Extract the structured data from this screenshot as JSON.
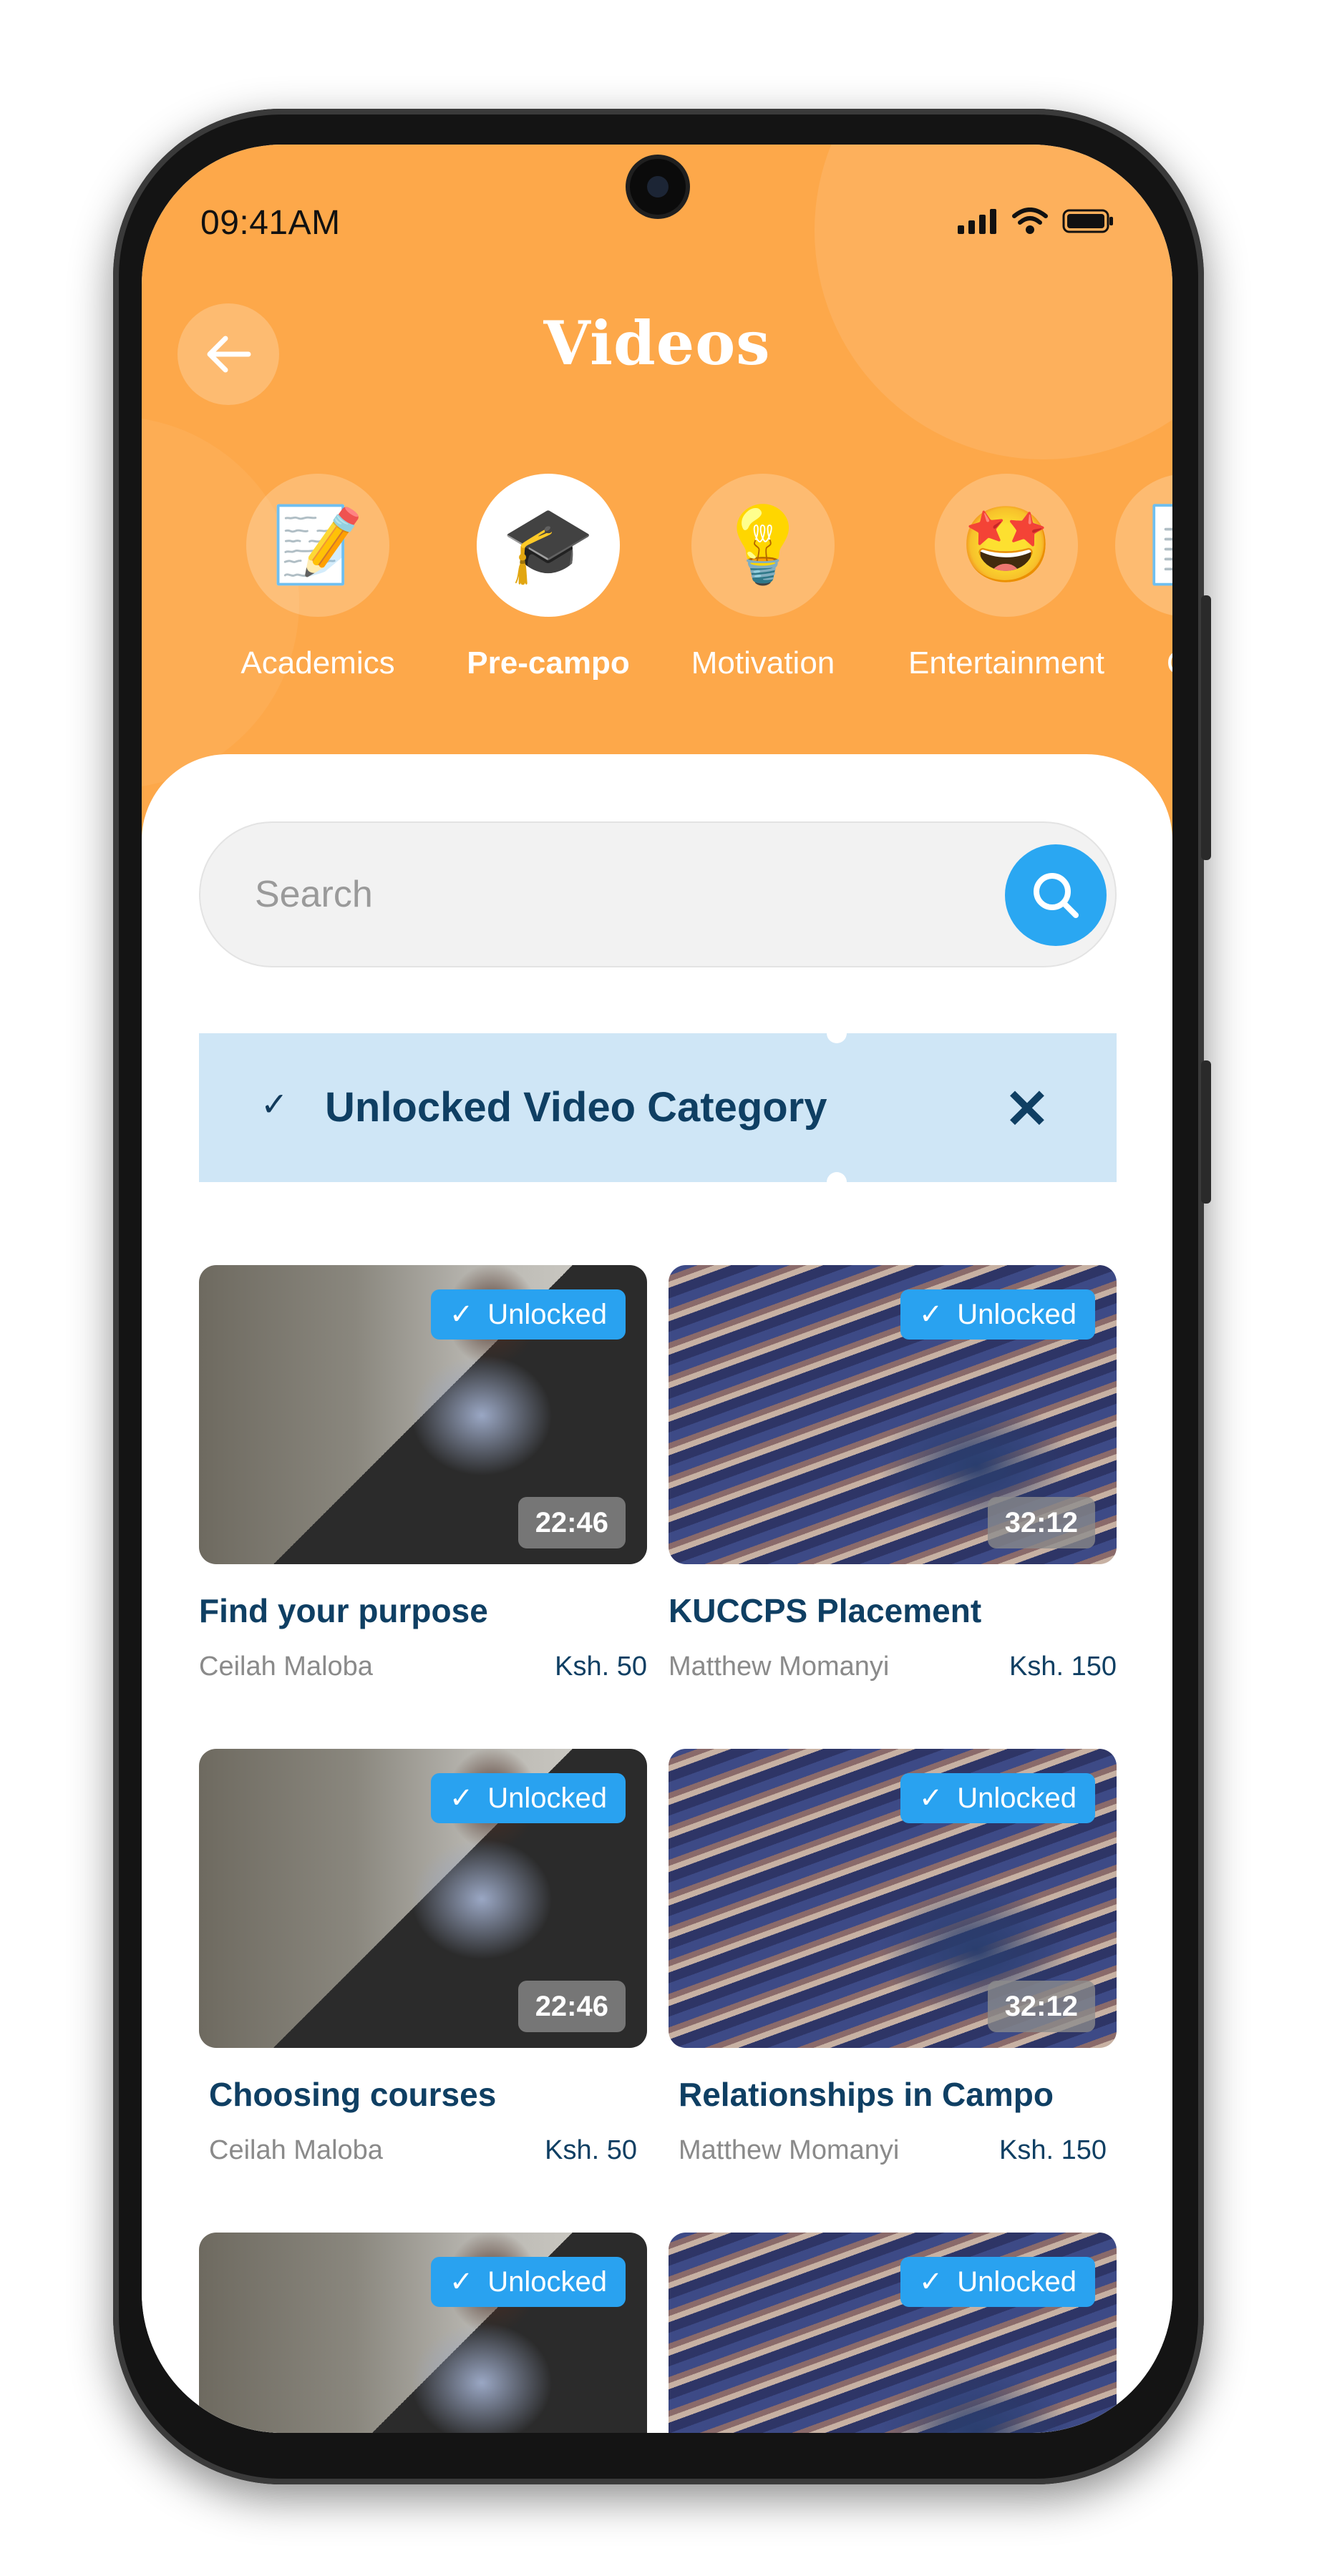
{
  "status_bar": {
    "time": "09:41AM"
  },
  "header": {
    "title": "Videos"
  },
  "categories": [
    {
      "label": "Academics",
      "icon": "document-checklist-icon",
      "glyph": "📝",
      "active": false
    },
    {
      "label": "Pre-campo",
      "icon": "graduation-cap-icon",
      "glyph": "🎓",
      "active": true
    },
    {
      "label": "Motivation",
      "icon": "lightbulb-icon",
      "glyph": "💡",
      "active": false
    },
    {
      "label": "Entertainment",
      "icon": "star-struck-icon",
      "glyph": "🤩",
      "active": false
    },
    {
      "label": "Co",
      "icon": "document-icon",
      "glyph": "📄",
      "active": false
    }
  ],
  "search": {
    "placeholder": "Search"
  },
  "banner": {
    "check": "✓",
    "text": "Unlocked Video Category",
    "close": "✕"
  },
  "videos": [
    {
      "title": "Find your purpose",
      "author": "Ceilah Maloba",
      "price": "Ksh. 50",
      "duration": "22:46",
      "badge": "Unlocked"
    },
    {
      "title": "KUCCPS Placement",
      "author": "Matthew Momanyi",
      "price": "Ksh. 150",
      "duration": "32:12",
      "badge": "Unlocked"
    },
    {
      "title": "Choosing courses",
      "author": "Ceilah Maloba",
      "price": "Ksh. 50",
      "duration": "22:46",
      "badge": "Unlocked"
    },
    {
      "title": "Relationships in Campo",
      "author": "Matthew Momanyi",
      "price": "Ksh. 150",
      "duration": "32:12",
      "badge": "Unlocked"
    },
    {
      "badge": "Unlocked"
    },
    {
      "badge": "Unlocked"
    }
  ],
  "colors": {
    "header": "#FDA84A",
    "accent": "#29A2F0",
    "navy": "#0F3F63",
    "banner": "#CFE6F6"
  }
}
